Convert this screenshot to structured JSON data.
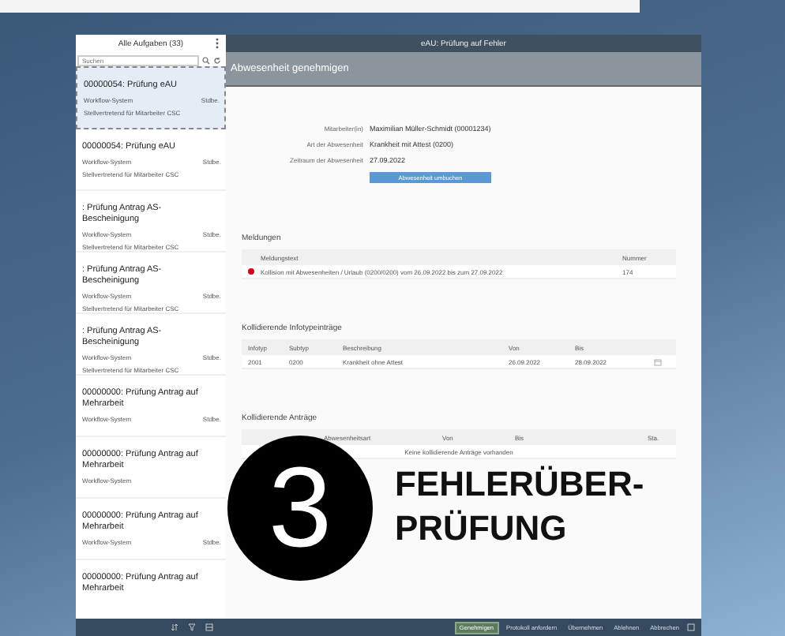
{
  "task_list": {
    "title": "Alle Aufgaben (33)",
    "search": {
      "placeholder": "Suchen"
    },
    "items": [
      {
        "title": "00000054: Prüfung eAU",
        "sender": "Workflow-System",
        "status": "Stdbe.",
        "note": "Stellvertretend für Mitarbeiter CSC",
        "selected": true
      },
      {
        "title": "00000054: Prüfung eAU",
        "sender": "Workflow-System",
        "status": "Stdbe.",
        "note": "Stellvertretend für Mitarbeiter CSC",
        "selected": false
      },
      {
        "title": ": Prüfung Antrag AS-Bescheinigung",
        "sender": "Workflow-System",
        "status": "Stdbe.",
        "note": "Stellvertretend für Mitarbeiter CSC",
        "selected": false
      },
      {
        "title": ": Prüfung Antrag AS-Bescheinigung",
        "sender": "Workflow-System",
        "status": "Stdbe.",
        "note": "Stellvertretend für Mitarbeiter CSC",
        "selected": false
      },
      {
        "title": ": Prüfung Antrag AS-Bescheinigung",
        "sender": "Workflow-System",
        "status": "Stdbe.",
        "note": "Stellvertretend für Mitarbeiter CSC",
        "selected": false
      },
      {
        "title": "00000000: Prüfung Antrag auf Mehrarbeit",
        "sender": "Workflow-System",
        "status": "Stdbe.",
        "selected": false
      },
      {
        "title": "00000000: Prüfung Antrag auf Mehrarbeit",
        "sender": "Workflow-System",
        "selected": false
      },
      {
        "title": "00000000: Prüfung Antrag auf Mehrarbeit",
        "sender": "Workflow-System",
        "status": "Stdbe.",
        "selected": false
      },
      {
        "title": "00000000: Prüfung Antrag auf Mehrarbeit",
        "selected": false
      }
    ]
  },
  "window": {
    "title": "eAU: Prüfung auf Fehler",
    "subtitle": "Abwesenheit genehmigen"
  },
  "details": [
    {
      "label": "Mitarbeiter(in)",
      "value": "Maximilian Müller-Schmidt (00001234)"
    },
    {
      "label": "Art der Abwesenheit",
      "value": "Krankheit mit Attest (0200)"
    },
    {
      "label": "Zeitraum der Abwesenheit",
      "value": "27.09.2022"
    }
  ],
  "detail_button": "Abwesenheit umbuchen",
  "messages": {
    "title": "Meldungen",
    "columns": [
      "Meldungstext",
      "Nummer"
    ],
    "rows": [
      {
        "color": "#d0021b",
        "text": "Kollision mit Abwesenheiten / Urlaub (0200/0200) vom 26.09.2022 bis zum 27.09.2022",
        "number": "174"
      }
    ]
  },
  "infotypes": {
    "title": "Kollidierende Infotypeinträge",
    "columns": [
      "Infotyp",
      "Subtyp",
      "Beschreibung",
      "Von",
      "Bis"
    ],
    "rows": [
      [
        "2001",
        "0200",
        "Krankheit ohne Attest",
        "26.09.2022",
        "28.09.2022"
      ]
    ]
  },
  "requests": {
    "title": "Kollidierende Anträge",
    "columns": [
      "Abwesenheitsart",
      "Von",
      "Bis",
      "Sta."
    ],
    "empty": "Keine kollidierende Anträge vorhanden"
  },
  "footer_buttons": [
    {
      "label": "Genehmigen",
      "selected": true
    },
    {
      "label": "Protokoll anfordern",
      "selected": false
    },
    {
      "label": "Übernehmen",
      "selected": false
    },
    {
      "label": "Ablehnen",
      "selected": false
    },
    {
      "label": "Abbrechen",
      "selected": false
    }
  ],
  "badge": {
    "number": "3",
    "lines": [
      "FEHLERÜBER-",
      "PRÜFUNG"
    ]
  }
}
